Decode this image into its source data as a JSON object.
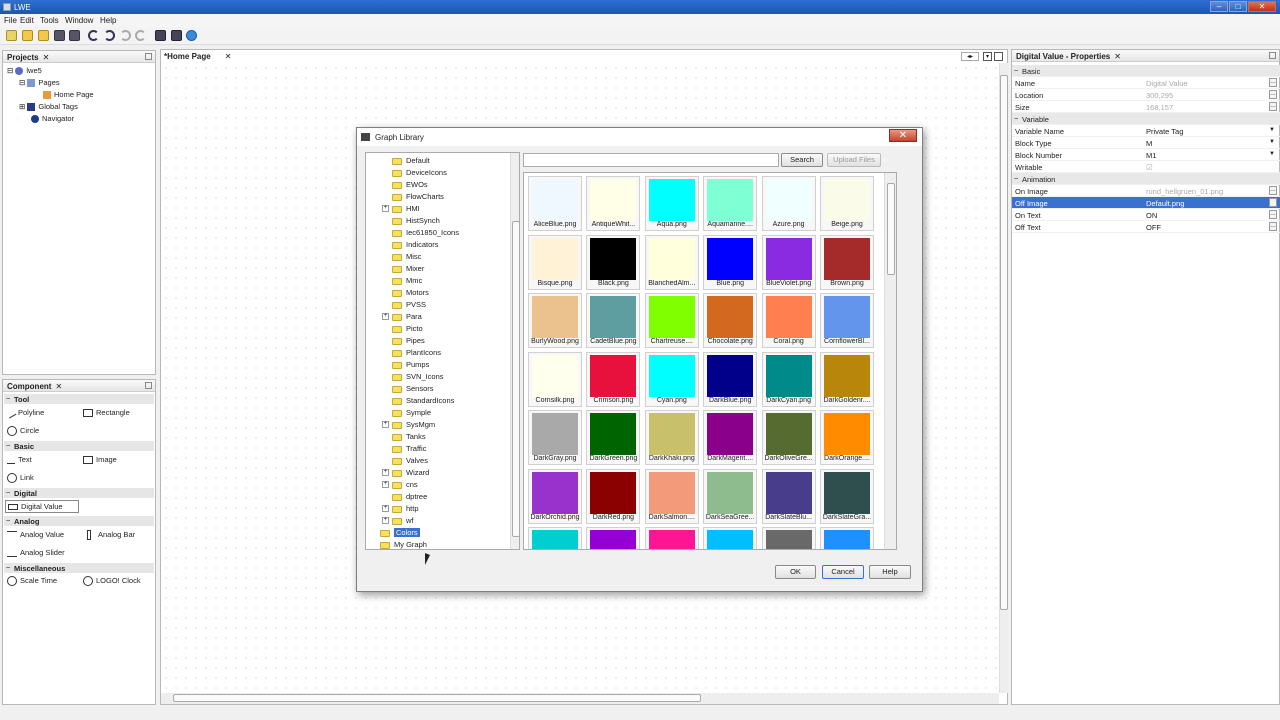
{
  "window": {
    "title": "LWE",
    "minimize": "–",
    "maximize": "□",
    "close": "✕"
  },
  "menu": [
    "File",
    "Edit",
    "Tools",
    "Window",
    "Help"
  ],
  "projects": {
    "header": "Projects",
    "items": [
      {
        "label": "lwe5",
        "icon": "project-icon"
      },
      {
        "label": "Pages",
        "icon": "pages-icon"
      },
      {
        "label": "Home Page",
        "icon": "home-icon"
      },
      {
        "label": "Global Tags",
        "icon": "tags-icon"
      },
      {
        "label": "Navigator",
        "icon": "navigator-icon"
      }
    ]
  },
  "component": {
    "header": "Component",
    "categories": {
      "tool": "Tool",
      "basic": "Basic",
      "digital": "Digital",
      "analog": "Analog",
      "misc": "Miscellaneous"
    },
    "items": {
      "polyline": "Polyline",
      "rectangle": "Rectangle",
      "circle": "Circle",
      "text": "Text",
      "image": "Image",
      "link": "Link",
      "digital_value": "Digital Value",
      "analog_value": "Analog Value",
      "analog_bar": "Analog Bar",
      "analog_slider": "Analog Slider",
      "scale_time": "Scale Time",
      "logo_clock": "LOGO! Clock"
    }
  },
  "editor": {
    "tab": "*Home Page"
  },
  "properties": {
    "header": "Digital Value - Properties",
    "rows": [
      {
        "type": "section",
        "key": "Basic"
      },
      {
        "key": "Name",
        "value": "Digital Value",
        "gray": true,
        "btn": true
      },
      {
        "key": "Location",
        "value": "300,295",
        "gray": true,
        "btn": true
      },
      {
        "key": "Size",
        "value": "168,157",
        "gray": true,
        "btn": true
      },
      {
        "type": "section",
        "key": "Variable"
      },
      {
        "key": "Variable Name",
        "value": "Private Tag",
        "dd": true
      },
      {
        "key": "Block Type",
        "value": "M",
        "dd": true
      },
      {
        "key": "Block Number",
        "value": "M1",
        "dd": true
      },
      {
        "key": "Writable",
        "value": "☑",
        "gray": true
      },
      {
        "type": "section",
        "key": "Animation"
      },
      {
        "key": "On Image",
        "value": "rund_hellgruen_01.png",
        "gray": true,
        "btn": true
      },
      {
        "key": "Off Image",
        "value": "Default.png",
        "btn": true,
        "selected": true
      },
      {
        "key": "On Text",
        "value": "ON",
        "btn": true
      },
      {
        "key": "Off Text",
        "value": "OFF",
        "btn": true
      }
    ]
  },
  "dialog": {
    "title": "Graph Library",
    "search_button": "Search",
    "upload_button": "Upload Files",
    "ok": "OK",
    "cancel": "Cancel",
    "help": "Help",
    "folders": [
      {
        "label": "Default"
      },
      {
        "label": "DeviceIcons"
      },
      {
        "label": "EWOs"
      },
      {
        "label": "FlowCharts"
      },
      {
        "label": "HMI",
        "plus": true
      },
      {
        "label": "HistSynch"
      },
      {
        "label": "Iec61850_Icons"
      },
      {
        "label": "Indicators"
      },
      {
        "label": "Misc"
      },
      {
        "label": "Mixer"
      },
      {
        "label": "Mmc"
      },
      {
        "label": "Motors"
      },
      {
        "label": "PVSS"
      },
      {
        "label": "Para",
        "plus": true
      },
      {
        "label": "Picto"
      },
      {
        "label": "Pipes"
      },
      {
        "label": "PlantIcons"
      },
      {
        "label": "Pumps"
      },
      {
        "label": "SVN_Icons"
      },
      {
        "label": "Sensors"
      },
      {
        "label": "StandardIcons"
      },
      {
        "label": "Symple"
      },
      {
        "label": "SysMgm",
        "plus": true
      },
      {
        "label": "Tanks"
      },
      {
        "label": "Traffic"
      },
      {
        "label": "Valves"
      },
      {
        "label": "Wizard",
        "plus": true
      },
      {
        "label": "cns",
        "plus": true
      },
      {
        "label": "dptree"
      },
      {
        "label": "http",
        "plus": true
      },
      {
        "label": "wf",
        "plus": true
      },
      {
        "label": "Colors",
        "root": true,
        "selected": true
      },
      {
        "label": "My Graph",
        "root": true
      }
    ],
    "tiles": [
      {
        "name": "AliceBlue.png",
        "color": "#F0F8FF"
      },
      {
        "name": "AntiqueWhit...",
        "color": "#FFFFE8"
      },
      {
        "name": "Aqua.png",
        "color": "#00FFFF"
      },
      {
        "name": "Aquamarine....",
        "color": "#7FFFD4"
      },
      {
        "name": "Azure.png",
        "color": "#F0FFFF"
      },
      {
        "name": "Beige.png",
        "color": "#FBFBEA"
      },
      {
        "name": "Bisque.png",
        "color": "#FFF2D6"
      },
      {
        "name": "Black.png",
        "color": "#000000"
      },
      {
        "name": "BlanchedAlm...",
        "color": "#FFFFDC"
      },
      {
        "name": "Blue.png",
        "color": "#0000FF"
      },
      {
        "name": "BlueViolet.png",
        "color": "#8A2BE2"
      },
      {
        "name": "Brown.png",
        "color": "#A52A2A"
      },
      {
        "name": "BurlyWood.png",
        "color": "#EBC18E"
      },
      {
        "name": "CadetBlue.png",
        "color": "#5F9EA0"
      },
      {
        "name": "Chartreuse....",
        "color": "#7FFF00"
      },
      {
        "name": "Chocolate.png",
        "color": "#D2691E"
      },
      {
        "name": "Coral.png",
        "color": "#FF7F50"
      },
      {
        "name": "CornflowerBl...",
        "color": "#6495ED"
      },
      {
        "name": "Cornsilk.png",
        "color": "#FFFFEE"
      },
      {
        "name": "Crimson.png",
        "color": "#E8103C"
      },
      {
        "name": "Cyan.png",
        "color": "#00FFFF"
      },
      {
        "name": "DarkBlue.png",
        "color": "#00008B"
      },
      {
        "name": "DarkCyan.png",
        "color": "#008B8B"
      },
      {
        "name": "DarkGoldenr....",
        "color": "#B8860B"
      },
      {
        "name": "DarkGray.png",
        "color": "#A9A9A9"
      },
      {
        "name": "DarkGreen.png",
        "color": "#006400"
      },
      {
        "name": "DarkKhaki.png",
        "color": "#C8C06A"
      },
      {
        "name": "DarkMagent....",
        "color": "#8B008B"
      },
      {
        "name": "DarkOliveGre...",
        "color": "#556B2F"
      },
      {
        "name": "DarkOrange....",
        "color": "#FF8C00"
      },
      {
        "name": "DarkOrchid.png",
        "color": "#9932CC"
      },
      {
        "name": "DarkRed.png",
        "color": "#8B0000"
      },
      {
        "name": "DarkSalmon....",
        "color": "#F39A7A"
      },
      {
        "name": "DarkSeaGree...",
        "color": "#8FBC8F"
      },
      {
        "name": "DarkSlateBlu...",
        "color": "#483D8B"
      },
      {
        "name": "DarkSlateGra...",
        "color": "#2F4F4F"
      },
      {
        "name": "",
        "color": "#00CED1"
      },
      {
        "name": "",
        "color": "#9400D3"
      },
      {
        "name": "",
        "color": "#FF1493"
      },
      {
        "name": "",
        "color": "#00BFFF"
      },
      {
        "name": "",
        "color": "#696969"
      },
      {
        "name": "",
        "color": "#1E90FF"
      }
    ]
  }
}
